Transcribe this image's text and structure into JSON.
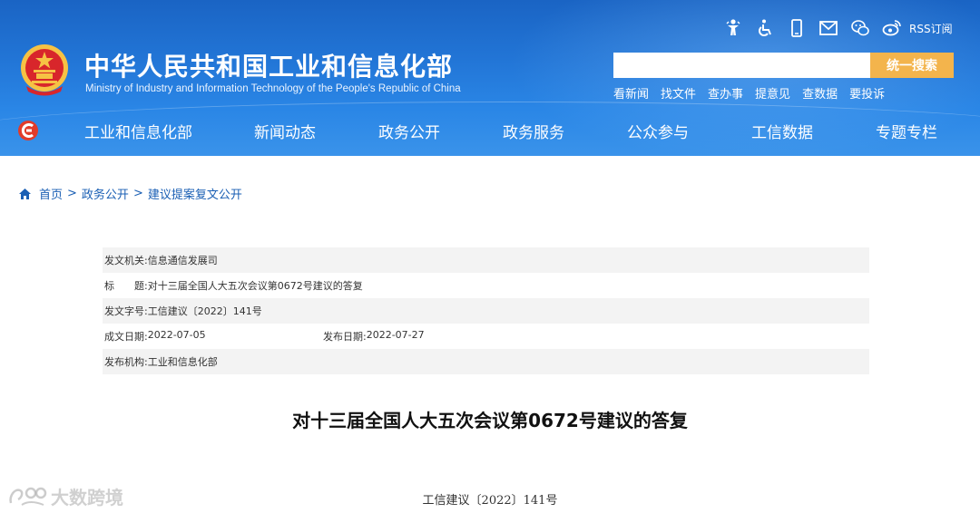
{
  "header": {
    "site_title": "中华人民共和国工业和信息化部",
    "site_subtitle": "Ministry of Industry and Information Technology of the People's Republic of China",
    "top_icons": [
      "accessibility-figure-icon",
      "wheelchair-icon",
      "mobile-phone-icon",
      "mail-icon",
      "wechat-icon",
      "weibo-icon"
    ],
    "rss_label": "RSS订阅",
    "search": {
      "value": "",
      "placeholder": "",
      "button_label": "统一搜索"
    },
    "quick_links": [
      "看新闻",
      "找文件",
      "查办事",
      "提意见",
      "查数据",
      "要投诉"
    ]
  },
  "nav": {
    "items": [
      "工业和信息化部",
      "新闻动态",
      "政务公开",
      "政务服务",
      "公众参与",
      "工信数据",
      "专题专栏"
    ]
  },
  "breadcrumb": [
    "首页",
    "政务公开",
    "建议提案复文公开"
  ],
  "meta": {
    "issuer_label": "发文机关:",
    "issuer": "信息通信发展司",
    "title_label": "标　　题:",
    "title": "对十三届全国人大五次会议第0672号建议的答复",
    "doc_no_label": "发文字号:",
    "doc_no": "工信建议〔2022〕141号",
    "created_label": "成文日期:",
    "created": "2022-07-05",
    "published_label": "发布日期:",
    "published": "2022-07-27",
    "org_label": "发布机构:",
    "org": "工业和信息化部"
  },
  "document": {
    "heading": "对十三届全国人大五次会议第0672号建议的答复",
    "number": "工信建议〔2022〕141号"
  },
  "watermark": {
    "text": "大数跨境"
  },
  "colors": {
    "header_blue": "#2275d6",
    "search_button": "#f3b44c",
    "link_blue": "#1a5fb4",
    "row_shade": "#f3f3f3"
  }
}
